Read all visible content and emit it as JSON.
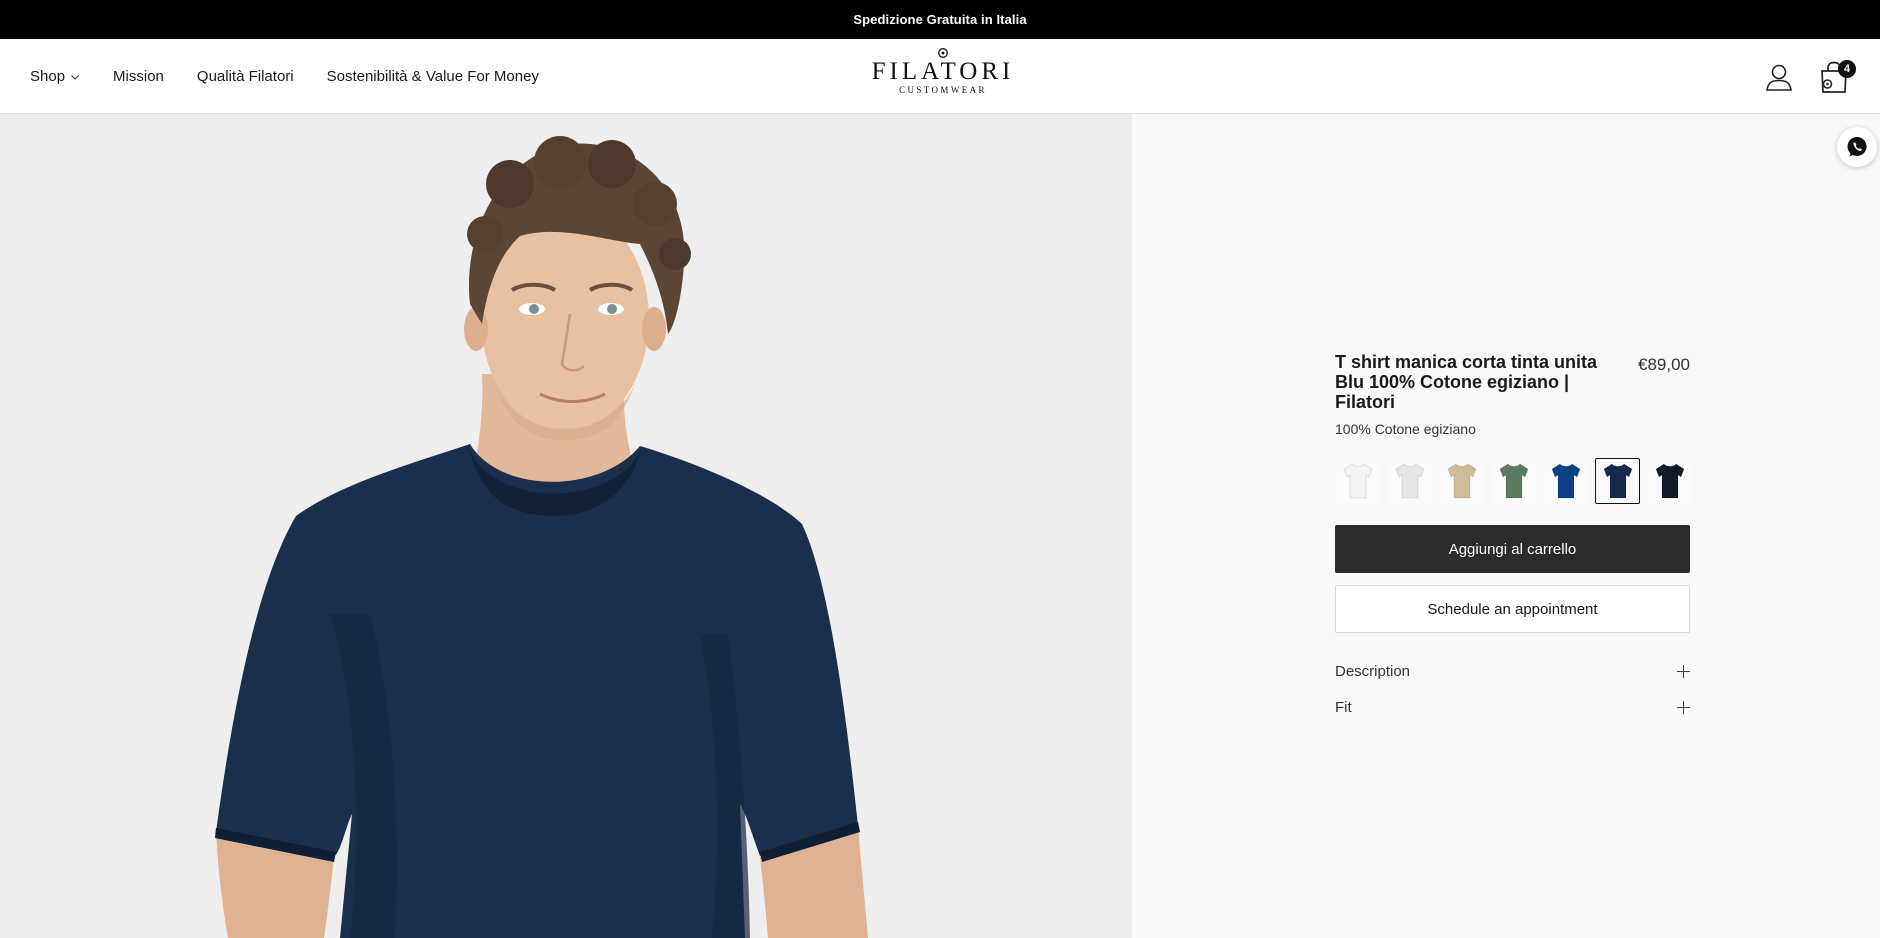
{
  "announcement": "Spedizione Gratuita in Italia",
  "nav": {
    "shop": "Shop",
    "mission": "Mission",
    "quality": "Qualità Filatori",
    "sustainability": "Sostenibilità & Value For Money"
  },
  "logo": {
    "name": "FILATORI",
    "subtitle": "CUSTOMWEAR"
  },
  "header_icons": {
    "account": "user-icon",
    "cart": "shopping-bag-icon",
    "cart_count": "4"
  },
  "gallery": {
    "image": "man-wearing-navy-tshirt"
  },
  "product": {
    "title": "T shirt manica corta tinta unita Blu 100% Cotone egiziano | Filatori",
    "price": "€89,00",
    "material": "100% Cotone egiziano",
    "swatches": [
      {
        "color": "#f4f4f6",
        "selected": false
      },
      {
        "color": "#e6e6e6",
        "selected": false
      },
      {
        "color": "#cdbb9a",
        "selected": false
      },
      {
        "color": "#5b7a5f",
        "selected": false
      },
      {
        "color": "#0d3f87",
        "selected": false
      },
      {
        "color": "#17284b",
        "selected": true
      },
      {
        "color": "#121826",
        "selected": false
      }
    ],
    "add_to_cart": "Aggiungi al carrello",
    "appointment": "Schedule an appointment",
    "accordions": {
      "description": "Description",
      "fit": "Fit"
    }
  },
  "floating": {
    "whatsapp_icon": "whatsapp-icon"
  },
  "colors": {
    "announcement_bg": "#000000",
    "primary_button": "#2b2b2b",
    "panel_bg": "#faf9f9",
    "gallery_bg": "#eeeeee",
    "shirt_navy": "#1a2f4c"
  }
}
